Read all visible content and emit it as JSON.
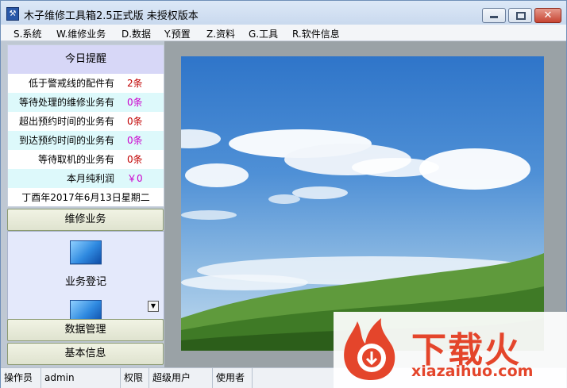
{
  "window": {
    "title": "木子维修工具箱2.5正式版 未授权版本",
    "close_glyph": "✕"
  },
  "menu": [
    "S.系统",
    "W.维修业务",
    "D.数据",
    "Y.预置",
    "Z.资料",
    "G.工具",
    "R.软件信息"
  ],
  "reminder": {
    "header": "今日提醒",
    "rows": [
      {
        "label": "低于警戒线的配件有",
        "value": "2条",
        "color": "#c00000"
      },
      {
        "label": "等待处理的维修业务有",
        "value": "0条",
        "color": "#cc00cc"
      },
      {
        "label": "超出预约时间的业务有",
        "value": "0条",
        "color": "#c00000"
      },
      {
        "label": "到达预约时间的业务有",
        "value": "0条",
        "color": "#cc00cc"
      },
      {
        "label": "等待取机的业务有",
        "value": "0条",
        "color": "#c00000"
      },
      {
        "label": "本月纯利润",
        "value": "￥0",
        "color": "#cc00cc"
      }
    ],
    "date": "丁酉年2017年6月13日星期二"
  },
  "nav": {
    "repair": "维修业务",
    "panel_item": "业务登记",
    "data_mgmt": "数据管理",
    "basic_info": "基本信息",
    "scroll_glyph": "▼"
  },
  "status": {
    "operator_label": "操作员",
    "operator": "admin",
    "role_label": "权限",
    "role": "超级用户",
    "user_label": "使用者"
  },
  "watermark": {
    "text": "下载火",
    "url": "xiazaihuo.com"
  },
  "colors": {
    "accent_red": "#e4452b",
    "reminder_header": "#d7d7f7",
    "row_alt": "#ddf9fb"
  }
}
